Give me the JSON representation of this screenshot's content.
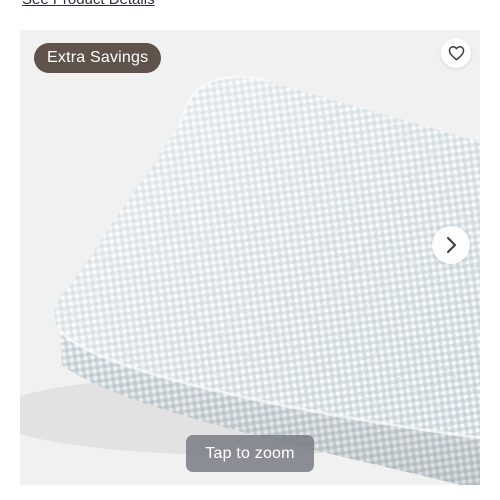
{
  "top_link": {
    "label": "See Product Details"
  },
  "gallery": {
    "badge_label": "Extra Savings",
    "zoom_label": "Tap to zoom",
    "favorite_icon": "heart-icon",
    "next_icon": "chevron-right-icon"
  },
  "colors": {
    "badge_bg": "#5f534c",
    "zoom_bg": "#787c84",
    "gallery_bg": "#f1f1f1",
    "pad_check": "#9fb3bd"
  }
}
